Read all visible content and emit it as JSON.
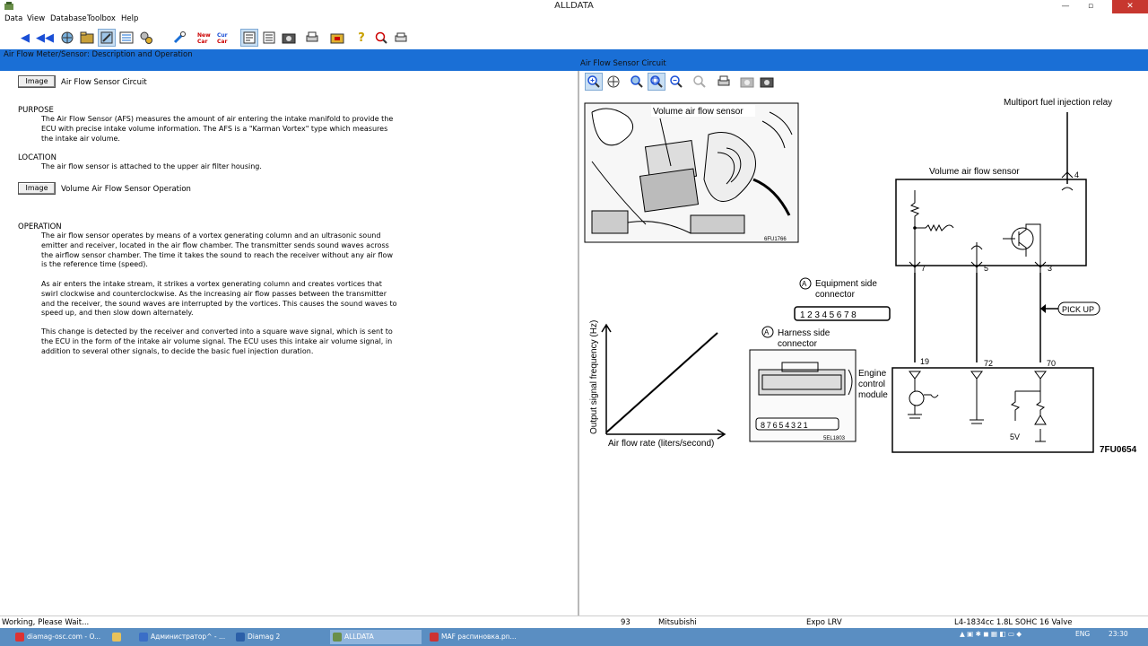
{
  "window": {
    "title": "ALLDATA",
    "controls": {
      "minimize": "—",
      "maximize": "▫",
      "close": "✕"
    }
  },
  "menu": [
    "Data",
    "View",
    "Database",
    "Toolbox",
    "Help"
  ],
  "panes": {
    "left_title": "Air Flow Meter/Sensor:  Description and Operation",
    "right_title": "Air Flow Sensor Circuit"
  },
  "content": {
    "image_button_label": "Image",
    "image_link_1": "Air Flow Sensor Circuit",
    "purpose_heading": "PURPOSE",
    "purpose_text": "The Air Flow Sensor (AFS) measures the amount of air entering the intake manifold to provide the ECU with precise intake volume information. The AFS is a \"Karman Vortex\" type which measures the intake air volume.",
    "location_heading": "LOCATION",
    "location_text": "The air flow sensor is attached to the upper air filter housing.",
    "image_link_2": "Volume Air Flow Sensor Operation",
    "operation_heading": "OPERATION",
    "operation_p1": "The air flow sensor operates by means of a vortex generating column and an ultrasonic sound emitter and receiver, located in the air flow chamber. The transmitter sends sound waves across the airflow sensor chamber. The time it takes the sound to reach the receiver without any air flow is the reference time (speed).",
    "operation_p2": "As air enters the intake stream, it strikes a vortex generating column and creates vortices that swirl clockwise and counterclockwise. As the increasing air flow passes between the transmitter and the receiver, the sound waves are interrupted by the vortices. This causes the sound waves to speed up, and then slow down alternately.",
    "operation_p3": "This change is detected by the receiver and converted into a square wave signal, which is sent to the ECU in the form of the intake air volume signal. The ECU uses this intake air volume signal, in addition to several other signals, to decide the basic fuel injection duration."
  },
  "diagram": {
    "photo_label": "Volume air flow sensor",
    "photo_code": "6FU1766",
    "relay_label": "Multiport fuel injection relay",
    "sensor_box_label": "Volume air flow sensor",
    "pin_4": "4",
    "pin_7": "7",
    "pin_5": "5",
    "pin_3": "3",
    "equip_marker": "A",
    "equip_label_1": "Equipment side",
    "equip_label_2": "connector",
    "equip_pins": "12345678",
    "pickup_label": "PICK UP",
    "harness_marker": "A",
    "harness_label_1": "Harness side",
    "harness_label_2": "connector",
    "harness_pins": "87654321",
    "harness_code": "5EL1803",
    "ecm_label_1": "Engine",
    "ecm_label_2": "control",
    "ecm_label_3": "module",
    "pin_19": "19",
    "pin_72": "72",
    "pin_70": "70",
    "v5": "5V",
    "fig_code": "7FU0654",
    "graph_ylabel": "Output signal frequency (Hz)",
    "graph_xlabel": "Air flow rate (liters/second)"
  },
  "status": {
    "message": "Working,  Please Wait...",
    "page": "93",
    "make": "Mitsubishi",
    "model": "Expo LRV",
    "engine": "L4-1834cc 1.8L SOHC 16 Valve"
  },
  "taskbar": {
    "items": [
      {
        "label": "diamag-osc.com - O...",
        "color": "#d33"
      },
      {
        "label": "",
        "color": "#e8c25a"
      },
      {
        "label": "Администратор^ - ...",
        "color": "#3a6ec7"
      },
      {
        "label": "Diamag 2",
        "color": "#2b5fa8"
      },
      {
        "label": "ALLDATA",
        "color": "#6a8f4a"
      },
      {
        "label": "MAF распиновка.pn...",
        "color": "#c33"
      }
    ],
    "lang": "ENG",
    "clock": "23:30"
  }
}
